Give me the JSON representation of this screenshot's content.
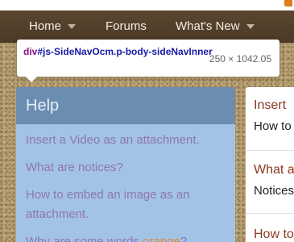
{
  "colors": {
    "nav_bg": "#4b3a27",
    "help_bg": "#a3c3e6",
    "help_header": "#6b8db1",
    "link_purple": "#8d76b3",
    "card_title": "#8b3a20"
  },
  "nav": {
    "items": [
      {
        "label": "Home",
        "has_dropdown": true
      },
      {
        "label": "Forums",
        "has_dropdown": false
      },
      {
        "label": "What's New",
        "has_dropdown": true
      }
    ]
  },
  "tooltip": {
    "tag": "div",
    "selector": "#js-SideNavOcm.p-body-sideNavInner",
    "dimensions": "250 × 1042.05"
  },
  "help": {
    "title": "Help",
    "items": [
      "Insert a Video as an attachment.",
      "What are notices?",
      "How to embed an image as an attachment.",
      "Why are some words orange?"
    ],
    "orange_word": "orange"
  },
  "right_cards": [
    {
      "title": "Insert",
      "subtitle": "How to"
    },
    {
      "title": "What a",
      "subtitle": "Notices"
    },
    {
      "title": "How to",
      "subtitle": ""
    }
  ]
}
